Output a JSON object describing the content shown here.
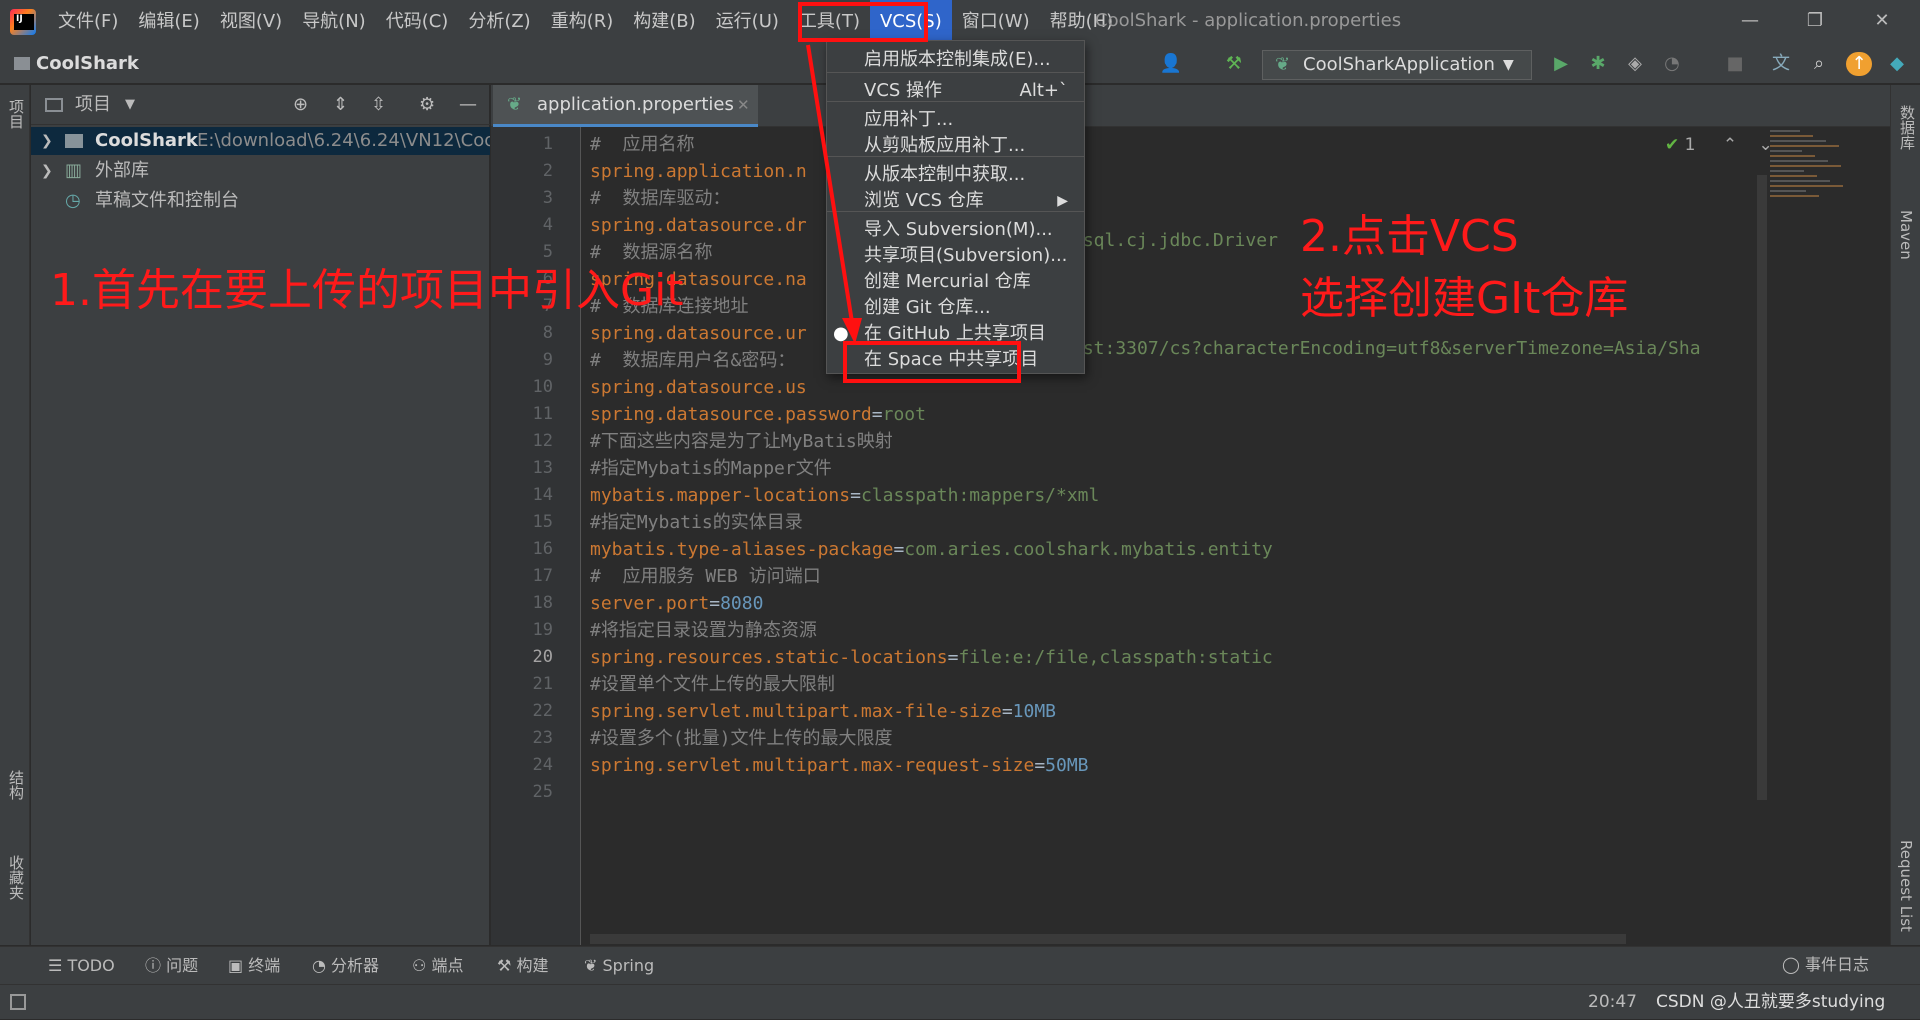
{
  "window": {
    "title": "CoolShark - application.properties",
    "minimize_icon": "—",
    "maximize_icon": "❐",
    "close_icon": "✕"
  },
  "menu": [
    "文件(F)",
    "编辑(E)",
    "视图(V)",
    "导航(N)",
    "代码(C)",
    "分析(Z)",
    "重构(R)",
    "构建(B)",
    "运行(U)",
    "工具(T)",
    "VCS(S)",
    "窗口(W)",
    "帮助(H)"
  ],
  "navbar": {
    "project": "CoolShark",
    "run_config": "CoolSharkApplication"
  },
  "left_strip": {
    "project": "项目",
    "structure": "结构",
    "favorites": "收藏夹"
  },
  "right_strip": {
    "database": "数据库",
    "maven": "Maven",
    "request_list": "Request List"
  },
  "project_panel": {
    "header": "项目",
    "tree": [
      {
        "name": "CoolShark",
        "path": "E:\\download\\6.24\\6.24\\VN12\\Coo"
      },
      {
        "name": "外部库",
        "path": ""
      },
      {
        "name": "草稿文件和控制台",
        "path": ""
      }
    ]
  },
  "editor": {
    "tab": "application.properties",
    "problems_count": "1",
    "current_line": 20,
    "lines": [
      {
        "n": "1",
        "t": "c",
        "text": "#  应用名称"
      },
      {
        "n": "2",
        "t": "kv",
        "key": "spring.application.n",
        "val": ""
      },
      {
        "n": "3",
        "t": "c",
        "text": "#  数据库驱动："
      },
      {
        "n": "4",
        "t": "kv",
        "key": "spring.datasource.dr",
        "val": ""
      },
      {
        "n": "5",
        "t": "c",
        "text": "#  数据源名称"
      },
      {
        "n": "6",
        "t": "kv",
        "key": "spring.datasource.na",
        "val": ""
      },
      {
        "n": "7",
        "t": "c",
        "text": "#  数据库连接地址"
      },
      {
        "n": "8",
        "t": "kv",
        "key": "spring.datasource.ur",
        "val": ""
      },
      {
        "n": "9",
        "t": "c",
        "text": "#  数据库用户名&密码："
      },
      {
        "n": "10",
        "t": "kv",
        "key": "spring.datasource.us",
        "val": ""
      },
      {
        "n": "11",
        "t": "kv",
        "key": "spring.datasource.password",
        "val": "root"
      },
      {
        "n": "12",
        "t": "c",
        "text": "#下面这些内容是为了让MyBatis映射"
      },
      {
        "n": "13",
        "t": "c",
        "text": "#指定Mybatis的Mapper文件"
      },
      {
        "n": "14",
        "t": "kv",
        "key": "mybatis.mapper-locations",
        "val": "classpath:mappers/*xml"
      },
      {
        "n": "15",
        "t": "c",
        "text": "#指定Mybatis的实体目录"
      },
      {
        "n": "16",
        "t": "kv",
        "key": "mybatis.type-aliases-package",
        "val": "com.aries.coolshark.mybatis.entity"
      },
      {
        "n": "17",
        "t": "c",
        "text": "#  应用服务 WEB 访问端口"
      },
      {
        "n": "18",
        "t": "kvn",
        "key": "server.port",
        "val": "8080"
      },
      {
        "n": "19",
        "t": "c",
        "text": "#将指定目录设置为静态资源"
      },
      {
        "n": "20",
        "t": "kv",
        "key": "spring.resources.static-locations",
        "val": "file:e:/file,classpath:static"
      },
      {
        "n": "21",
        "t": "c",
        "text": "#设置单个文件上传的最大限制"
      },
      {
        "n": "22",
        "t": "kvn",
        "key": "spring.servlet.multipart.max-file-size",
        "val": "10MB"
      },
      {
        "n": "23",
        "t": "c",
        "text": "#设置多个(批量)文件上传的最大限度"
      },
      {
        "n": "24",
        "t": "kvn",
        "key": "spring.servlet.multipart.max-request-size",
        "val": "50MB"
      },
      {
        "n": "25",
        "t": "c",
        "text": ""
      }
    ],
    "peek_right": {
      "line4": "ysql.cj.jdbc.Driver",
      "line8": "ost:3307/cs?characterEncoding=utf8&serverTimezone=Asia/Sha"
    }
  },
  "vcs_menu": {
    "items": [
      {
        "label": "启用版本控制集成(E)...",
        "shortcut": ""
      },
      {
        "label": "VCS 操作",
        "shortcut": "Alt+`"
      },
      {
        "label": "应用补丁...",
        "shortcut": ""
      },
      {
        "label": "从剪贴板应用补丁...",
        "shortcut": ""
      },
      {
        "label": "从版本控制中获取...",
        "shortcut": ""
      },
      {
        "label": "浏览 VCS 仓库",
        "shortcut": "▶"
      },
      {
        "label": "导入 Subversion(M)...",
        "shortcut": ""
      },
      {
        "label": "共享项目(Subversion)...",
        "shortcut": ""
      },
      {
        "label": "创建 Mercurial 仓库",
        "shortcut": ""
      },
      {
        "label": "创建 Git 仓库...",
        "shortcut": ""
      },
      {
        "label": "在 GitHub 上共享项目",
        "shortcut": ""
      },
      {
        "label": "在 Space 中共享项目",
        "shortcut": ""
      }
    ]
  },
  "annotations": {
    "step1": "1.首先在要上传的项目中引入Git",
    "step2_line1": "2.点击VCS",
    "step2_line2": "选择创建GIt仓库"
  },
  "toolwindows": [
    "TODO",
    "问题",
    "终端",
    "分析器",
    "端点",
    "构建",
    "Spring"
  ],
  "status": {
    "event_log": "事件日志",
    "time": "20:47",
    "watermark": "CSDN @人丑就要多studying"
  },
  "colors": {
    "accent": "#2f65ca",
    "annotation_red": "#ff1010",
    "key": "#cc7832",
    "value": "#6a8759",
    "number": "#6897bb",
    "comment": "#808080"
  }
}
